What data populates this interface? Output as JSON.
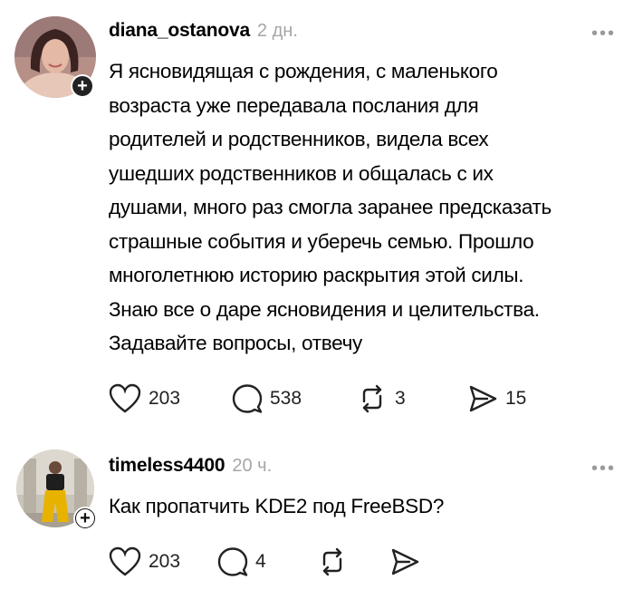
{
  "posts": [
    {
      "username": "diana_ostanova",
      "time": "2 дн.",
      "more": "•••",
      "lines": [
        "Я ясновидящая с рождения, с маленького",
        "возраста уже передавала послания для",
        "родителей и родственников, видела всех",
        "ушедших родственников и общалась с их",
        "душами, много раз смогла заранее предсказать",
        "страшные события и уберечь семью. Прошло",
        "многолетнюю историю раскрытия этой силы.",
        "Знаю все о даре ясновидения и целительства.",
        "Задавайте вопросы, отвечу"
      ],
      "likes": "203",
      "replies": "538",
      "reposts": "3",
      "shares": "15"
    },
    {
      "username": "timeless4400",
      "time": "20 ч.",
      "more": "•••",
      "lines": [
        "Как пропатчить KDE2 под FreeBSD?"
      ],
      "likes": "203",
      "replies": "4",
      "reposts": "",
      "shares": ""
    }
  ],
  "icons": {
    "follow": "plus-icon",
    "like": "heart-icon",
    "reply": "comment-icon",
    "repost": "repost-icon",
    "share": "send-icon"
  }
}
